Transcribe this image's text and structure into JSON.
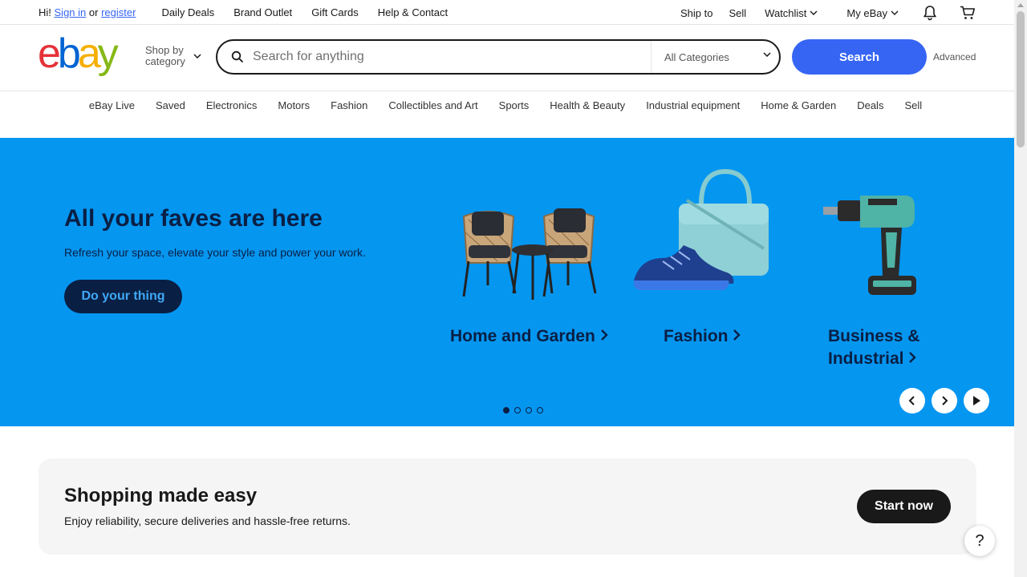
{
  "topbar": {
    "greeting": "Hi!",
    "sign_in": "Sign in",
    "or": "or",
    "register": "register",
    "links": [
      "Daily Deals",
      "Brand Outlet",
      "Gift Cards",
      "Help & Contact"
    ],
    "ship_to": "Ship to",
    "sell": "Sell",
    "watchlist": "Watchlist",
    "my_ebay": "My eBay",
    "icons": [
      "bell-icon",
      "cart-icon"
    ]
  },
  "header": {
    "logo": {
      "e": "e",
      "b": "b",
      "a": "a",
      "y": "y"
    },
    "logo_colors": {
      "e": "#e53238",
      "b": "#0064d2",
      "a": "#f5af02",
      "y": "#86b817"
    },
    "shop_by_line1": "Shop by",
    "shop_by_line2": "category",
    "search_placeholder": "Search for anything",
    "category_select": "All Categories",
    "search_button": "Search",
    "advanced": "Advanced"
  },
  "nav": {
    "items": [
      "eBay Live",
      "Saved",
      "Electronics",
      "Motors",
      "Fashion",
      "Collectibles and Art",
      "Sports",
      "Health & Beauty",
      "Industrial equipment",
      "Home & Garden",
      "Deals",
      "Sell"
    ]
  },
  "hero": {
    "title": "All your faves are here",
    "subtitle": "Refresh your space, elevate your style and power your work.",
    "cta": "Do your thing",
    "tiles": [
      {
        "label": "Home and Garden",
        "icon": "patio-furniture-image"
      },
      {
        "label": "Fashion",
        "icon": "bag-and-sneaker-image"
      },
      {
        "label_line1": "Business &",
        "label_line2": "Industrial",
        "icon": "power-drill-image"
      }
    ],
    "slides_total": 4,
    "active_slide": 1,
    "background": "#0596f0"
  },
  "easy": {
    "title": "Shopping made easy",
    "subtitle": "Enjoy reliability, secure deliveries and hassle-free returns.",
    "button": "Start now"
  },
  "help_label": "?",
  "colors": {
    "accent": "#3665f3",
    "hero_text": "#0a1f44"
  }
}
